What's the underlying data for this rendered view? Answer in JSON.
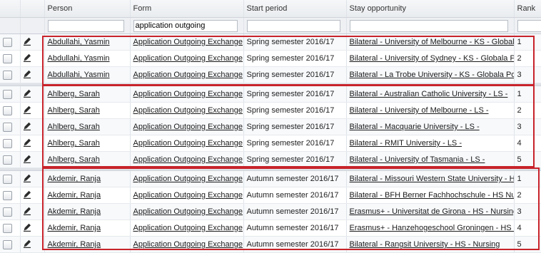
{
  "columns": [
    "",
    "",
    "Person",
    "Form",
    "Start period",
    "Stay opportunity",
    "Rank"
  ],
  "filters": {
    "person": "",
    "form": "application outgoing",
    "start": "",
    "stay": "",
    "rank": ""
  },
  "groups": [
    {
      "rows": [
        {
          "person": "Abdullahi, Yasmin",
          "form": "Application Outgoing Exchange",
          "start": "Spring semester 2016/17",
          "stay": "Bilateral - University of Melbourne - KS - Global",
          "rank": "1"
        },
        {
          "person": "Abdullahi, Yasmin",
          "form": "Application Outgoing Exchange",
          "start": "Spring semester 2016/17",
          "stay": "Bilateral - University of Sydney - KS - Globala P",
          "rank": "2"
        },
        {
          "person": "Abdullahi, Yasmin",
          "form": "Application Outgoing Exchange",
          "start": "Spring semester 2016/17",
          "stay": "Bilateral - La Trobe University - KS - Globala Pol",
          "rank": "3"
        }
      ]
    },
    {
      "rows": [
        {
          "person": "Ahlberg, Sarah",
          "form": "Application Outgoing Exchange",
          "start": "Spring semester 2016/17",
          "stay": "Bilateral - Australian Catholic University - LS -",
          "rank": "1"
        },
        {
          "person": "Ahlberg, Sarah",
          "form": "Application Outgoing Exchange",
          "start": "Spring semester 2016/17",
          "stay": "Bilateral - University of Melbourne - LS -",
          "rank": "2"
        },
        {
          "person": "Ahlberg, Sarah",
          "form": "Application Outgoing Exchange",
          "start": "Spring semester 2016/17",
          "stay": "Bilateral - Macquarie University - LS -",
          "rank": "3"
        },
        {
          "person": "Ahlberg, Sarah",
          "form": "Application Outgoing Exchange",
          "start": "Spring semester 2016/17",
          "stay": "Bilateral - RMIT University - LS -",
          "rank": "4"
        },
        {
          "person": "Ahlberg, Sarah",
          "form": "Application Outgoing Exchange",
          "start": "Spring semester 2016/17",
          "stay": "Bilateral - University of Tasmania - LS -",
          "rank": "5"
        }
      ]
    },
    {
      "rows": [
        {
          "person": "Akdemir, Ranja",
          "form": "Application Outgoing Exchange",
          "start": "Autumn semester 2016/17",
          "stay": "Bilateral - Missouri Western State University - H",
          "rank": "1"
        },
        {
          "person": "Akdemir, Ranja",
          "form": "Application Outgoing Exchange",
          "start": "Autumn semester 2016/17",
          "stay": "Bilateral - BFH Berner Fachhochschule - HS Nursi",
          "rank": "2"
        },
        {
          "person": "Akdemir, Ranja",
          "form": "Application Outgoing Exchange",
          "start": "Autumn semester 2016/17",
          "stay": "Erasmus+ - Universitat de Girona - HS - Nursing",
          "rank": "3"
        },
        {
          "person": "Akdemir, Ranja",
          "form": "Application Outgoing Exchange",
          "start": "Autumn semester 2016/17",
          "stay": "Erasmus+ - Hanzehogeschool Groningen - HS -",
          "rank": "4"
        },
        {
          "person": "Akdemir, Ranja",
          "form": "Application Outgoing Exchange",
          "start": "Autumn semester 2016/17",
          "stay": "Bilateral - Rangsit University - HS - Nursing",
          "rank": "5"
        }
      ]
    }
  ],
  "colors": {
    "highlight": "#c8232b"
  }
}
